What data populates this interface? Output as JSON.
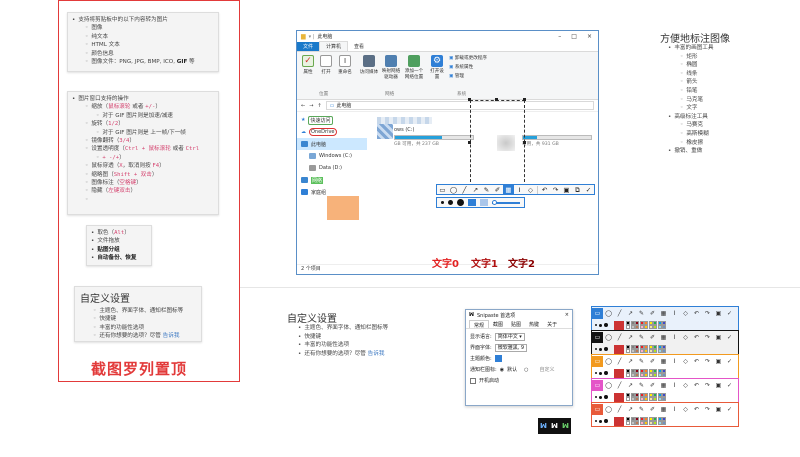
{
  "left_panel": {
    "box1_items": [
      {
        "level": 1,
        "text": "支持将剪贴板中的以下内容转为图片"
      },
      {
        "level": 2,
        "text": "图像"
      },
      {
        "level": 2,
        "text": "纯文本"
      },
      {
        "level": 2,
        "text": "HTML 文本"
      },
      {
        "level": 2,
        "text": "颜色信息"
      },
      {
        "level": 2,
        "text_before": "图像文件：PNG, JPG, BMP, ICO, ",
        "bold": "GIF",
        "text_after": " 等"
      }
    ],
    "box2_items": [
      {
        "level": 1,
        "text": "图片窗口支持的操作"
      },
      {
        "level": 2,
        "text_before": "缩放（",
        "pink": "鼠标滚轮",
        "text_mid": " 或者 ",
        "pink2": "+/-",
        "text_after": "）"
      },
      {
        "level": 3,
        "text": "对于 GIF 图片则是加速/减速"
      },
      {
        "level": 2,
        "text_before": "旋转（",
        "pink": "1/2",
        "text_after": "）"
      },
      {
        "level": 3,
        "text": "对于 GIF 图片则是 上一帧/下一帧"
      },
      {
        "level": 2,
        "text_before": "镜像翻转（",
        "pink": "3/4",
        "text_after": "）"
      },
      {
        "level": 2,
        "text_before": "设置透明度（",
        "pink": "Ctrl + 鼠标滚轮",
        "text_mid": " 或者 ",
        "pink2": "Ctrl"
      },
      {
        "level": 3,
        "pink": "+ -/+",
        "text_after": "）"
      },
      {
        "level": 2,
        "text_before": "鼠标穿透（",
        "pink": "X",
        "text_mid": "，取消则按 ",
        "pink2": "F4",
        "text_after": "）"
      },
      {
        "level": 2,
        "text_before": "缩略图（",
        "pink": "Shift + 双击",
        "text_after": "）"
      },
      {
        "level": 2,
        "text_before": "图像标注（",
        "pink": "空格键",
        "text_after": "）"
      },
      {
        "level": 2,
        "text_before": "隐藏（",
        "pink": "左键双击",
        "text_after": "）"
      },
      {
        "level": 2,
        "text": ""
      }
    ],
    "box3_items": [
      {
        "level": 1,
        "text_before": "取色（",
        "pink": "Alt",
        "text_after": "）"
      },
      {
        "level": 1,
        "text": "文件拖放"
      },
      {
        "level": 1,
        "bold": "贴图分组"
      },
      {
        "level": 1,
        "bold": "自动备份、恢复"
      }
    ],
    "box4": {
      "title": "自定义设置",
      "items": [
        {
          "text": "主题色、界面字体、通知栏图标等"
        },
        {
          "text": "快捷键"
        },
        {
          "text": "丰富的功能性选项"
        },
        {
          "text_before": "还有你想要的选项？尽管 ",
          "link": "告诉我"
        }
      ]
    },
    "caption": "截图罗列置顶"
  },
  "explorer": {
    "title": "此电脑",
    "tabs": [
      "文件",
      "计算机",
      "查看"
    ],
    "ribbon_buttons": [
      "属性",
      "打开",
      "重命名",
      "访问媒体",
      "映射网络驱动器",
      "添加一个网络位置",
      "打开设置"
    ],
    "ribbon_right": [
      "卸载或更改程序",
      "系统属性",
      "管理"
    ],
    "groups": [
      "位置",
      "网络",
      "系统"
    ],
    "address": "此电脑",
    "nav_items": [
      "快速访问",
      "OneDrive",
      "此电脑",
      "Windows (C:)",
      "Data (D:)",
      "网络",
      "家庭组"
    ],
    "drive_c": {
      "label": "ows (C:)",
      "free": "GB 可用，共 237 GB",
      "fill": 0.6
    },
    "drive_d": {
      "label": "",
      "free": "可用，共 931 GB",
      "fill": 0.2
    },
    "status": "2 个项目",
    "overlay_words": [
      {
        "text": "文字0",
        "color": "#e32020"
      },
      {
        "text": "文字1",
        "color": "#b01010"
      },
      {
        "text": "文字2",
        "color": "#8a0000"
      }
    ]
  },
  "right_panel": {
    "title": "方便地标注图像",
    "items": [
      {
        "level": 1,
        "text": "丰富的画图工具"
      },
      {
        "level": 2,
        "text": "矩形"
      },
      {
        "level": 2,
        "text": "椭圆"
      },
      {
        "level": 2,
        "text": "线条"
      },
      {
        "level": 2,
        "text": "箭头"
      },
      {
        "level": 2,
        "text": "铅笔"
      },
      {
        "level": 2,
        "text": "马克笔"
      },
      {
        "level": 2,
        "text": "文字"
      },
      {
        "level": 1,
        "text": "高级标注工具"
      },
      {
        "level": 2,
        "text": "马赛克"
      },
      {
        "level": 2,
        "text": "高斯模糊"
      },
      {
        "level": 2,
        "text": "橡皮擦"
      },
      {
        "level": 1,
        "text": "撤销、重做"
      }
    ]
  },
  "bottom_middle": {
    "title": "自定义设置",
    "items": [
      {
        "text": "主题色、界面字体、通知栏图标等"
      },
      {
        "text": "快捷键"
      },
      {
        "text": "丰富的功能性选项"
      },
      {
        "text_before": "还有你想要的选项？尽管 ",
        "link": "告诉我"
      }
    ]
  },
  "prefs": {
    "title": "Snipaste 首选项",
    "tabs": [
      "常规",
      "截图",
      "贴图",
      "热键",
      "关于"
    ],
    "language_label": "显示语言:",
    "language_value": "简体中文",
    "font_label": "界面字体:",
    "font_value": "微软雅黑, 9",
    "theme_label": "主题颜色:",
    "tray_label": "通知栏图标:",
    "tray_default": "默认",
    "tray_custom": "自定义",
    "startup_label": "开机启动"
  },
  "colors": {
    "accent_blue": "#2f7fd6",
    "red": "#e23a3a",
    "theme_bars": [
      "#2f7fd6",
      "#111111",
      "#f29a1f",
      "#e455c8",
      "#e85a3a"
    ]
  },
  "icons": {
    "toolbar": [
      "rect-icon",
      "ellipse-icon",
      "line-icon",
      "arrow-icon",
      "pencil-icon",
      "marker-icon",
      "mosaic-icon",
      "text-icon",
      "eraser-icon",
      "undo-icon",
      "redo-icon",
      "save-icon",
      "copy-icon",
      "check-icon"
    ]
  }
}
